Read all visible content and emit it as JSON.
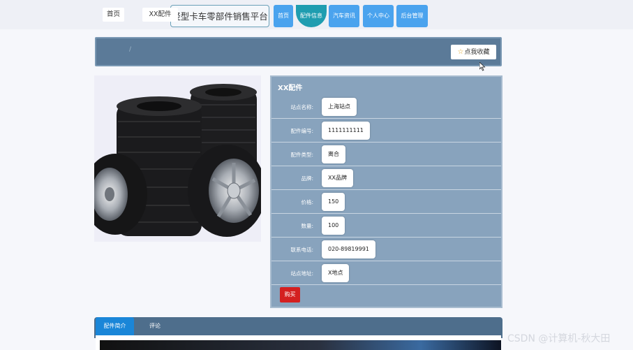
{
  "header": {
    "site_title": "轻型卡车零部件销售平台",
    "nav": [
      {
        "label": "首页",
        "active": false
      },
      {
        "label": "配件信息",
        "active": true
      },
      {
        "label": "汽车资讯",
        "active": false
      },
      {
        "label": "个人中心",
        "active": false
      },
      {
        "label": "后台管理",
        "active": false
      }
    ]
  },
  "breadcrumb": {
    "home": "首页",
    "separator": "/",
    "current": "XX配件"
  },
  "favorite_button": {
    "label": "点我收藏",
    "icon": "star-icon"
  },
  "product": {
    "image_alt_icon": "tire-stack-image",
    "title": "XX配件",
    "fields": [
      {
        "label": "站点名称:",
        "value": "上海站点"
      },
      {
        "label": "配件编号:",
        "value": "1111111111"
      },
      {
        "label": "配件类型:",
        "value": "离合"
      },
      {
        "label": "品牌:",
        "value": "XX品牌"
      },
      {
        "label": "价格:",
        "value": "150"
      },
      {
        "label": "数量:",
        "value": "100"
      },
      {
        "label": "联系电话:",
        "value": "020-89819991"
      },
      {
        "label": "站点地址:",
        "value": "X地点"
      }
    ],
    "buy_label": "购买"
  },
  "tabs": [
    {
      "label": "配件简介",
      "active": true
    },
    {
      "label": "评论",
      "active": false
    }
  ],
  "watermark": "CSDN @计算机-秋大田",
  "colors": {
    "nav_blue": "#4aa3ee",
    "nav_active": "#1f9db0",
    "breadcrumb_bar": "#5b7a98",
    "detail_panel": "#88a3bd",
    "buy_red": "#d42020",
    "tab_active": "#1a86d8"
  }
}
